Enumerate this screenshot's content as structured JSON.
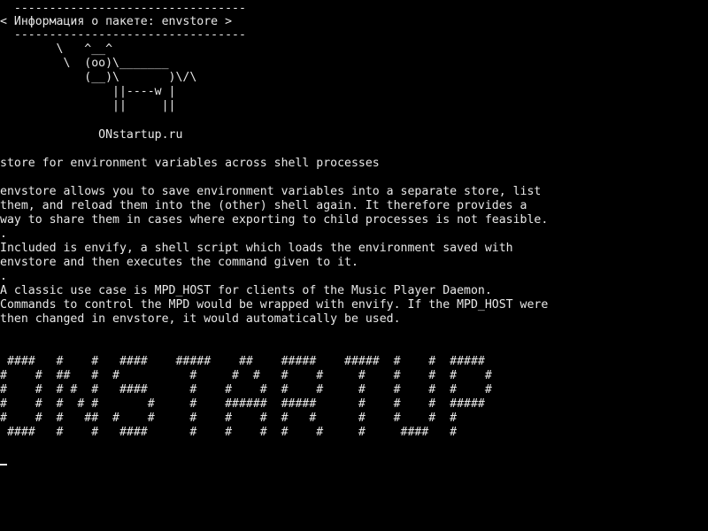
{
  "terminal": {
    "header": {
      "top_rule": "  ---------------------------------",
      "title": "< Информация о пакете: envstore >",
      "bottom_rule": "  ---------------------------------"
    },
    "cow_art": [
      "        \\   ^__^",
      "         \\  (oo)\\_______",
      "            (__)\\       )\\/\\",
      "                ||----w |",
      "                ||     ||"
    ],
    "site": "              ONstartup.ru",
    "summary": "store for environment variables across shell processes",
    "description": [
      "envstore allows you to save environment variables into a separate store, list",
      "them, and reload them into the (other) shell again. It therefore provides a",
      "way to share them in cases where exporting to child processes is not feasible.",
      ".",
      "Included is envify, a shell script which loads the environment saved with",
      "envstore and then executes the command given to it.",
      ".",
      "A classic use case is MPD_HOST for clients of the Music Player Daemon.",
      "Commands to control the MPD would be wrapped with envify. If the MPD_HOST were",
      "then changed in envstore, it would automatically be used."
    ],
    "banner": [
      " ####   #    #   ####    #####    ##    #####    #####  #    #  #####",
      "#    #  ##   #  #          #     #  #   #    #     #    #    #  #    #",
      "#    #  # #  #   ####      #    #    #  #    #     #    #    #  #    #",
      "#    #  #  # #       #     #    ######  #####      #    #    #  #####",
      "#    #  #   ##  #    #     #    #    #  #   #      #    #    #  #",
      " ####   #    #   ####      #    #    #  #    #     #     ####   #"
    ]
  }
}
